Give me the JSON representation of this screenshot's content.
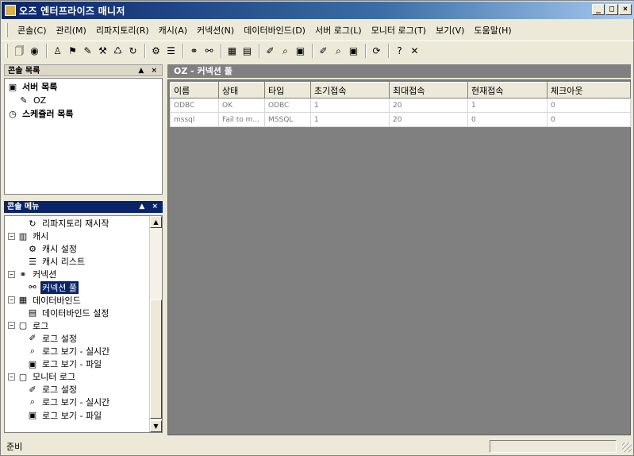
{
  "window": {
    "title": "오즈 엔터프라이즈 매니저",
    "controls": [
      "_",
      "□",
      "×"
    ]
  },
  "menubar": [
    "콘솔(C)",
    "관리(M)",
    "리파지토리(R)",
    "캐시(A)",
    "커넥션(N)",
    "데이터바인드(D)",
    "서버 로그(L)",
    "모니터 로그(T)",
    "보기(V)",
    "도움말(H)"
  ],
  "toolbar": {
    "icons": [
      {
        "name": "connect-icon",
        "glyph": "🗍"
      },
      {
        "name": "disconnect-icon",
        "glyph": "◉"
      },
      "sep",
      {
        "name": "user-icon",
        "glyph": "♙"
      },
      {
        "name": "group-icon",
        "glyph": "⚑"
      },
      {
        "name": "permission-icon",
        "glyph": "✎"
      },
      {
        "name": "tools-icon",
        "glyph": "⚒"
      },
      {
        "name": "repository-icon",
        "glyph": "♺"
      },
      {
        "name": "repository-restart-icon",
        "glyph": "↻"
      },
      "sep",
      {
        "name": "cache-setting-icon",
        "glyph": "⚙"
      },
      {
        "name": "cache-list-icon",
        "glyph": "☰"
      },
      "sep",
      {
        "name": "connection-icon",
        "glyph": "⚭"
      },
      {
        "name": "connection-pool-icon",
        "glyph": "⚯"
      },
      "sep",
      {
        "name": "databind-icon",
        "glyph": "▦"
      },
      {
        "name": "databind-setting-icon",
        "glyph": "▤"
      },
      "sep",
      {
        "name": "log-setting-icon",
        "glyph": "✐"
      },
      {
        "name": "log-realtime-icon",
        "glyph": "⌕"
      },
      {
        "name": "log-file-icon",
        "glyph": "▣"
      },
      "sep",
      {
        "name": "monitor-setting-icon",
        "glyph": "✐"
      },
      {
        "name": "monitor-realtime-icon",
        "glyph": "⌕"
      },
      {
        "name": "monitor-file-icon",
        "glyph": "▣"
      },
      "sep",
      {
        "name": "refresh-icon",
        "glyph": "⟳"
      },
      "sep",
      {
        "name": "help-icon",
        "glyph": "?"
      },
      {
        "name": "close-icon",
        "glyph": "✕"
      }
    ]
  },
  "server_pane": {
    "title": "콘솔 목록",
    "controls": "▲ ×",
    "items": [
      {
        "label": "서버 목록",
        "icon": "server-list-icon",
        "glyph": "▣",
        "bold": true,
        "indent": 0
      },
      {
        "label": "OZ",
        "icon": "server-icon",
        "glyph": "✎",
        "bold": false,
        "indent": 1
      },
      {
        "label": "스케쥴러 목록",
        "icon": "scheduler-list-icon",
        "glyph": "◷",
        "bold": true,
        "indent": 0
      }
    ]
  },
  "menu_pane": {
    "title": "콘솔 메뉴",
    "controls": "▲ ×",
    "items": [
      {
        "label": "리파지토리 재시작",
        "icon": "repository-restart-icon",
        "glyph": "↻",
        "level": 2,
        "expander": ""
      },
      {
        "label": "캐시",
        "icon": "cache-icon",
        "glyph": "▥",
        "level": 0,
        "expander": "−"
      },
      {
        "label": "캐시 설정",
        "icon": "cache-setting-icon",
        "glyph": "⚙",
        "level": 2,
        "expander": ""
      },
      {
        "label": "캐시 리스트",
        "icon": "cache-list-icon",
        "glyph": "☰",
        "level": 2,
        "expander": ""
      },
      {
        "label": "커넥션",
        "icon": "connection-icon",
        "glyph": "⚭",
        "level": 0,
        "expander": "−"
      },
      {
        "label": "커넥션 풀",
        "icon": "connection-pool-icon",
        "glyph": "⚯",
        "level": 2,
        "expander": "",
        "selected": true
      },
      {
        "label": "데이터바인드",
        "icon": "databind-icon",
        "glyph": "▦",
        "level": 0,
        "expander": "−"
      },
      {
        "label": "데이터바인드 설정",
        "icon": "databind-setting-icon",
        "glyph": "▤",
        "level": 2,
        "expander": ""
      },
      {
        "label": "로그",
        "icon": "log-icon",
        "glyph": "▢",
        "level": 0,
        "expander": "−"
      },
      {
        "label": "로그 설정",
        "icon": "log-setting-icon",
        "glyph": "✐",
        "level": 2,
        "expander": ""
      },
      {
        "label": "로그 보기 - 실시간",
        "icon": "log-realtime-icon",
        "glyph": "⌕",
        "level": 2,
        "expander": ""
      },
      {
        "label": "로그 보기 - 파일",
        "icon": "log-file-icon",
        "glyph": "▣",
        "level": 2,
        "expander": ""
      },
      {
        "label": "모니터 로그",
        "icon": "monitor-log-icon",
        "glyph": "▢",
        "level": 0,
        "expander": "−"
      },
      {
        "label": "로그 설정",
        "icon": "monitor-setting-icon",
        "glyph": "✐",
        "level": 2,
        "expander": ""
      },
      {
        "label": "로그 보기 - 실시간",
        "icon": "monitor-realtime-icon",
        "glyph": "⌕",
        "level": 2,
        "expander": ""
      },
      {
        "label": "로그 보기 - 파일",
        "icon": "monitor-file-icon",
        "glyph": "▣",
        "level": 2,
        "expander": ""
      }
    ]
  },
  "content": {
    "title": "OZ - 커넥션 풀",
    "columns": [
      "이름",
      "상태",
      "타입",
      "초기접속",
      "최대접속",
      "현재접속",
      "체크아웃"
    ],
    "rows": [
      [
        "ODBC",
        "OK",
        "ODBC",
        "1",
        "20",
        "1",
        "0"
      ],
      [
        "mssql",
        "Fail to m...",
        "MSSQL",
        "1",
        "20",
        "0",
        "0"
      ]
    ]
  },
  "statusbar": {
    "text": "준비"
  }
}
